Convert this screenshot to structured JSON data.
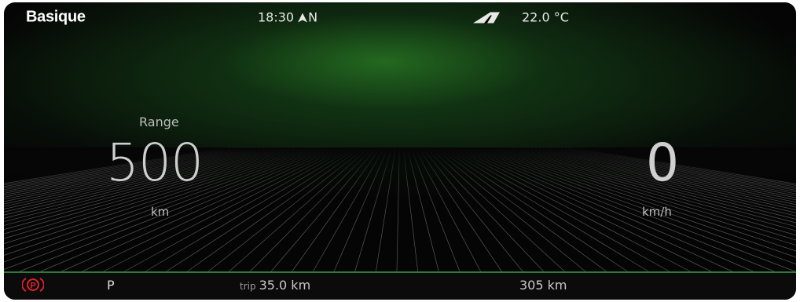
{
  "header": {
    "title": "Basique",
    "time": "18:30",
    "heading": "N",
    "temperature": "22.0 °C"
  },
  "gauges": {
    "range_label": "Range",
    "range_value": "500",
    "range_unit": "km",
    "speed_value": "0",
    "speed_unit": "km/h"
  },
  "footer": {
    "gear": "P",
    "trip_label": "trip",
    "trip_value": "35.0 km",
    "odometer": "305 km"
  },
  "colors": {
    "background": "#050505",
    "glow": "#1f6b22",
    "grid": "#9a9a9a",
    "parking_brake": "#e0202a",
    "accent_line": "#2f7a3a"
  },
  "icons": {
    "compass": "north-arrow-icon",
    "road": "road-icon",
    "parking_brake": "parking-brake-icon"
  }
}
